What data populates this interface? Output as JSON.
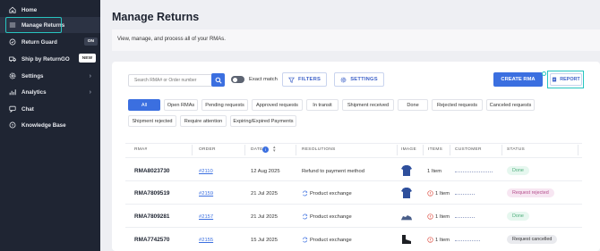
{
  "sidebar": {
    "items": [
      {
        "label": "Home",
        "icon": "home-icon"
      },
      {
        "label": "Manage Returns",
        "icon": "list-icon"
      },
      {
        "label": "Return Guard",
        "icon": "shield-icon",
        "badge": "ON"
      },
      {
        "label": "Ship by ReturnGO",
        "icon": "truck-icon",
        "badge": "NEW"
      },
      {
        "label": "Settings",
        "icon": "gear-icon"
      },
      {
        "label": "Analytics",
        "icon": "chart-icon"
      },
      {
        "label": "Chat",
        "icon": "chat-icon"
      },
      {
        "label": "Knowledge Base",
        "icon": "help-icon"
      }
    ]
  },
  "page": {
    "title": "Manage Returns",
    "subtitle": "View, manage, and process all of your RMAs."
  },
  "toolbar": {
    "search_placeholder": "Search RMA# or Order number",
    "exact_match": "Exact match",
    "filters": "FILTERS",
    "settings": "SETTINGS",
    "create": "CREATE RMA",
    "report": "REPORT"
  },
  "tabs": [
    "All",
    "Open RMAs",
    "Pending requests",
    "Approved requests",
    "In transit",
    "Shipment received",
    "Done",
    "Rejected requests",
    "Canceled requests",
    "Shipment rejected",
    "Require attention",
    "Expiring/Expired Payments"
  ],
  "table": {
    "headers": [
      "RMA#",
      "ORDER",
      "DATE",
      "RESOLUTIONS",
      "IMAGE",
      "ITEMS",
      "CUSTOMER",
      "STATUS"
    ],
    "rows": [
      {
        "rma": "RMA8023730",
        "order": "#2110",
        "date": "12 Aug 2025",
        "resolution": "Refund to payment method",
        "items": "1 Item",
        "status": "Done"
      },
      {
        "rma": "RMA7809519",
        "order": "#2159",
        "date": "21 Jul 2025",
        "resolution": "Product exchange",
        "items": "1 Item",
        "status": "Request rejected"
      },
      {
        "rma": "RMA7809281",
        "order": "#2157",
        "date": "21 Jul 2025",
        "resolution": "Product exchange",
        "items": "1 Item",
        "status": "Done"
      },
      {
        "rma": "RMA7742570",
        "order": "#2155",
        "date": "15 Jul 2025",
        "resolution": "Product exchange",
        "items": "1 Item",
        "status": "Request cancelled"
      }
    ]
  },
  "colors": {
    "accent": "#3b6fe0",
    "sidebar": "#1f2533",
    "highlight": "#27c4c0"
  }
}
